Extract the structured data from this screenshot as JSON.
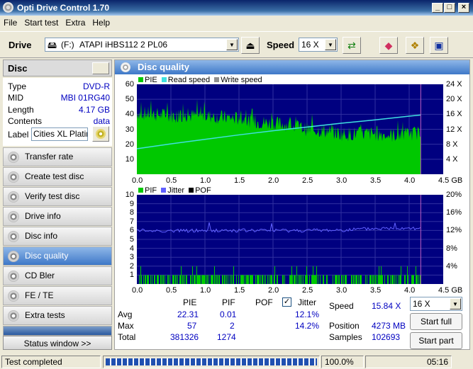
{
  "window": {
    "title": "Opti Drive Control 1.70"
  },
  "menu": [
    "File",
    "Start test",
    "Extra",
    "Help"
  ],
  "toolbar": {
    "drive_label": "Drive",
    "drive_letter": "(F:)",
    "drive_name": "ATAPI iHBS112   2 PL06",
    "speed_label": "Speed",
    "speed_value": "16 X"
  },
  "disc": {
    "header": "Disc",
    "type_label": "Type",
    "type_value": "DVD-R",
    "mid_label": "MID",
    "mid_value": "MBI 01RG40",
    "length_label": "Length",
    "length_value": "4.17 GB",
    "contents_label": "Contents",
    "contents_value": "data",
    "label_label": "Label",
    "label_value": "Cities XL Platin"
  },
  "nav": [
    "Transfer rate",
    "Create test disc",
    "Verify test disc",
    "Drive info",
    "Disc info",
    "Disc quality",
    "CD Bler",
    "FE / TE",
    "Extra tests"
  ],
  "nav_active": "Disc quality",
  "status_window": "Status window >>",
  "panel": {
    "title": "Disc quality"
  },
  "chart_data": [
    {
      "type": "area",
      "legend": [
        "PIE",
        "Read speed",
        "Write speed"
      ],
      "colors": {
        "pie": "#00c800",
        "read": "#40e0e0",
        "write": "#909090"
      },
      "x_ticks": [
        "0.0",
        "0.5",
        "1.0",
        "1.5",
        "2.0",
        "2.5",
        "3.0",
        "3.5",
        "4.0",
        "4.5 GB"
      ],
      "y_ticks_left": [
        "60",
        "50",
        "40",
        "30",
        "20",
        "10"
      ],
      "y_ticks_right": [
        "24 X",
        "20 X",
        "16 X",
        "12 X",
        "8 X",
        "4 X"
      ],
      "xlim": [
        0,
        4.5
      ],
      "ylim": [
        0,
        60
      ],
      "pie_series": {
        "x": [
          0,
          0.25,
          0.5,
          0.75,
          1.0,
          1.25,
          1.5,
          1.75,
          2.0,
          2.25,
          2.5,
          2.75,
          3.0,
          3.25,
          3.5,
          3.75,
          4.0,
          4.17
        ],
        "y": [
          42,
          41,
          40,
          40,
          40,
          39,
          38,
          36,
          35,
          34,
          31,
          30,
          28,
          28,
          28,
          27,
          28,
          29
        ]
      },
      "read_speed": {
        "x": [
          0,
          0.5,
          1.0,
          1.5,
          2.0,
          2.5,
          3.0,
          3.5,
          4.0,
          4.17
        ],
        "y": [
          6.8,
          8.1,
          9.3,
          10.5,
          11.6,
          12.6,
          13.6,
          14.5,
          15.5,
          15.8
        ]
      },
      "data_end": 4.17
    },
    {
      "type": "bar",
      "legend": [
        "PIF",
        "Jitter",
        "POF"
      ],
      "colors": {
        "pif": "#00c800",
        "jitter": "#6060ff",
        "pof": "#000000"
      },
      "x_ticks": [
        "0.0",
        "0.5",
        "1.0",
        "1.5",
        "2.0",
        "2.5",
        "3.0",
        "3.5",
        "4.0",
        "4.5 GB"
      ],
      "y_ticks_left": [
        "10",
        "9",
        "8",
        "7",
        "6",
        "5",
        "4",
        "3",
        "2",
        "1"
      ],
      "y_ticks_right": [
        "20%",
        "16%",
        "12%",
        "8%",
        "4%"
      ],
      "xlim": [
        0,
        4.5
      ],
      "ylim": [
        0,
        10
      ],
      "jitter_series": {
        "x": [
          0,
          0.5,
          1.0,
          1.5,
          2.0,
          2.5,
          3.0,
          3.5,
          4.0,
          4.17
        ],
        "y": [
          12.0,
          11.9,
          12.0,
          12.0,
          12.0,
          12.0,
          12.1,
          12.4,
          12.6,
          12.5
        ]
      },
      "data_end": 4.17
    }
  ],
  "stats": {
    "col_pie": "PIE",
    "col_pif": "PIF",
    "col_pof": "POF",
    "col_jitter": "Jitter",
    "avg_label": "Avg",
    "avg_pie": "22.31",
    "avg_pif": "0.01",
    "avg_jitter": "12.1%",
    "max_label": "Max",
    "max_pie": "57",
    "max_pif": "2",
    "max_jitter": "14.2%",
    "total_label": "Total",
    "total_pie": "381326",
    "total_pif": "1274",
    "speed_label": "Speed",
    "speed_value": "15.84 X",
    "speed_select": "16 X",
    "position_label": "Position",
    "position_value": "4273 MB",
    "samples_label": "Samples",
    "samples_value": "102693",
    "start_full": "Start full",
    "start_part": "Start part"
  },
  "statusbar": {
    "text": "Test completed",
    "progress": "100.0%",
    "progress_value": 1.0,
    "time": "05:16"
  }
}
